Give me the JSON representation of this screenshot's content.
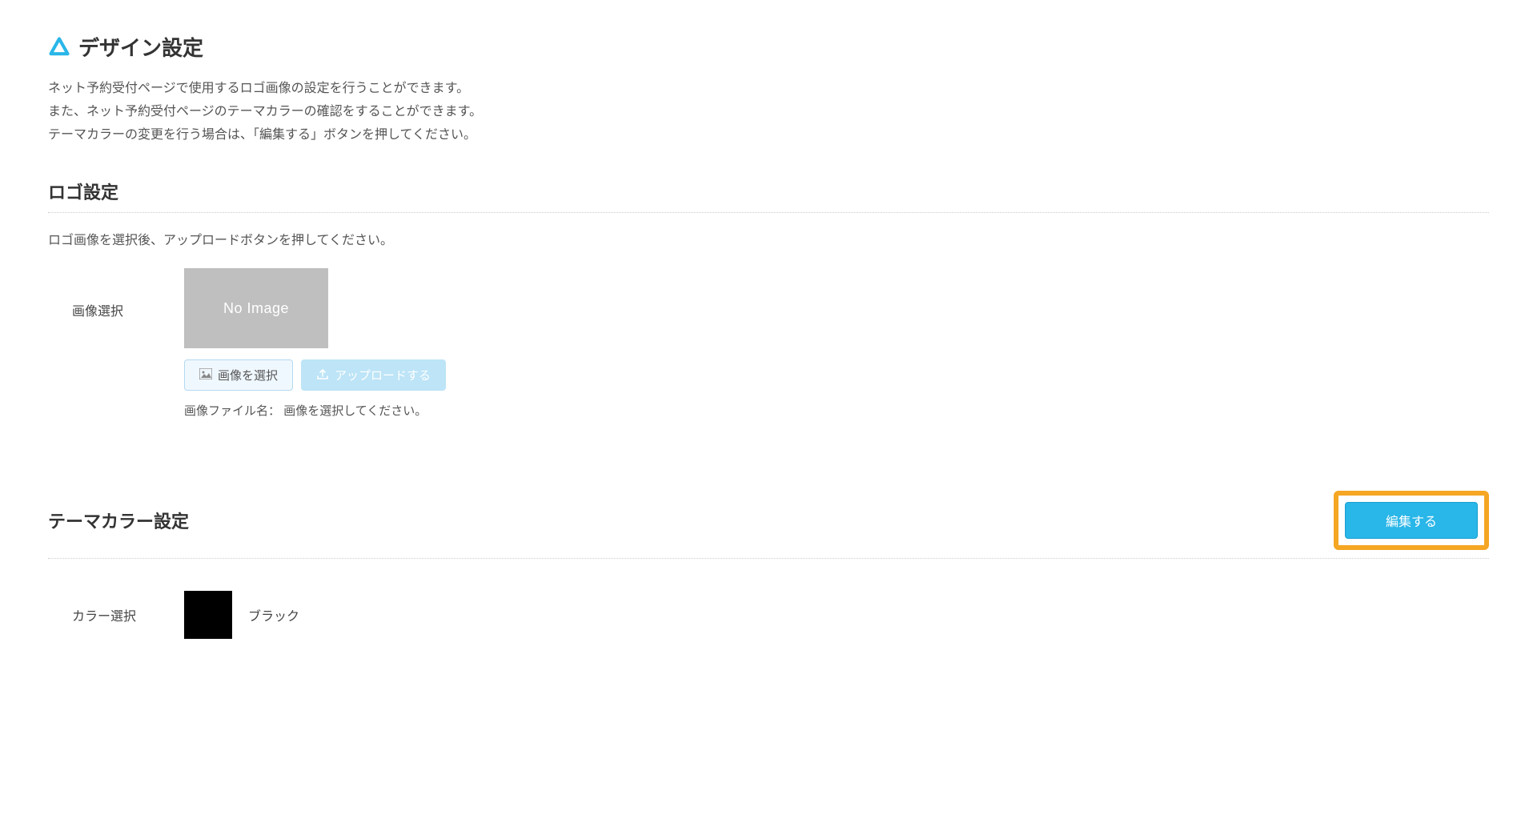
{
  "page": {
    "title": "デザイン設定",
    "description_line1": "ネット予約受付ページで使用するロゴ画像の設定を行うことができます。",
    "description_line2": "また、ネット予約受付ページのテーマカラーの確認をすることができます。",
    "description_line3": "テーマカラーの変更を行う場合は、「編集する」ボタンを押してください。"
  },
  "logo_section": {
    "title": "ロゴ設定",
    "helper": "ロゴ画像を選択後、アップロードボタンを押してください。",
    "field_label": "画像選択",
    "no_image_text": "No Image",
    "select_button": "画像を選択",
    "upload_button": "アップロードする",
    "filename_label": "画像ファイル名：",
    "filename_value": "画像を選択してください。"
  },
  "theme_section": {
    "title": "テーマカラー設定",
    "edit_button": "編集する",
    "field_label": "カラー選択",
    "color_name": "ブラック",
    "color_hex": "#000000"
  }
}
